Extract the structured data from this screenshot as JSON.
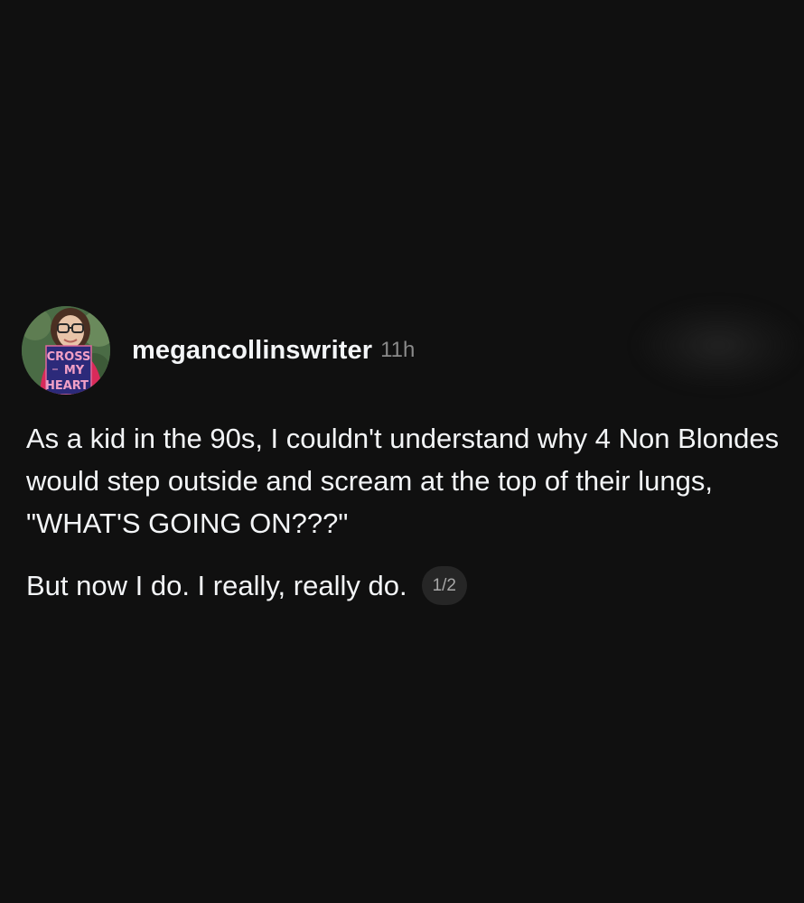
{
  "post": {
    "avatar": {
      "book_title_line1": "CROSS",
      "book_title_line2": "MY",
      "book_title_line3": "HEART"
    },
    "author": {
      "username": "megancollinswriter",
      "timestamp": "11h"
    },
    "text": {
      "paragraph_1": "As a kid in the 90s, I couldn't understand why 4 Non Blondes would step outside and scream at the top of their lungs, \"WHAT'S GOING ON???\"",
      "paragraph_2": "But now I do. I really, really do."
    },
    "pagination": "1/2"
  },
  "colors": {
    "background": "#101010",
    "text_primary": "#f3f5f7",
    "text_secondary": "#8a8a8a",
    "badge_background": "#262626"
  }
}
